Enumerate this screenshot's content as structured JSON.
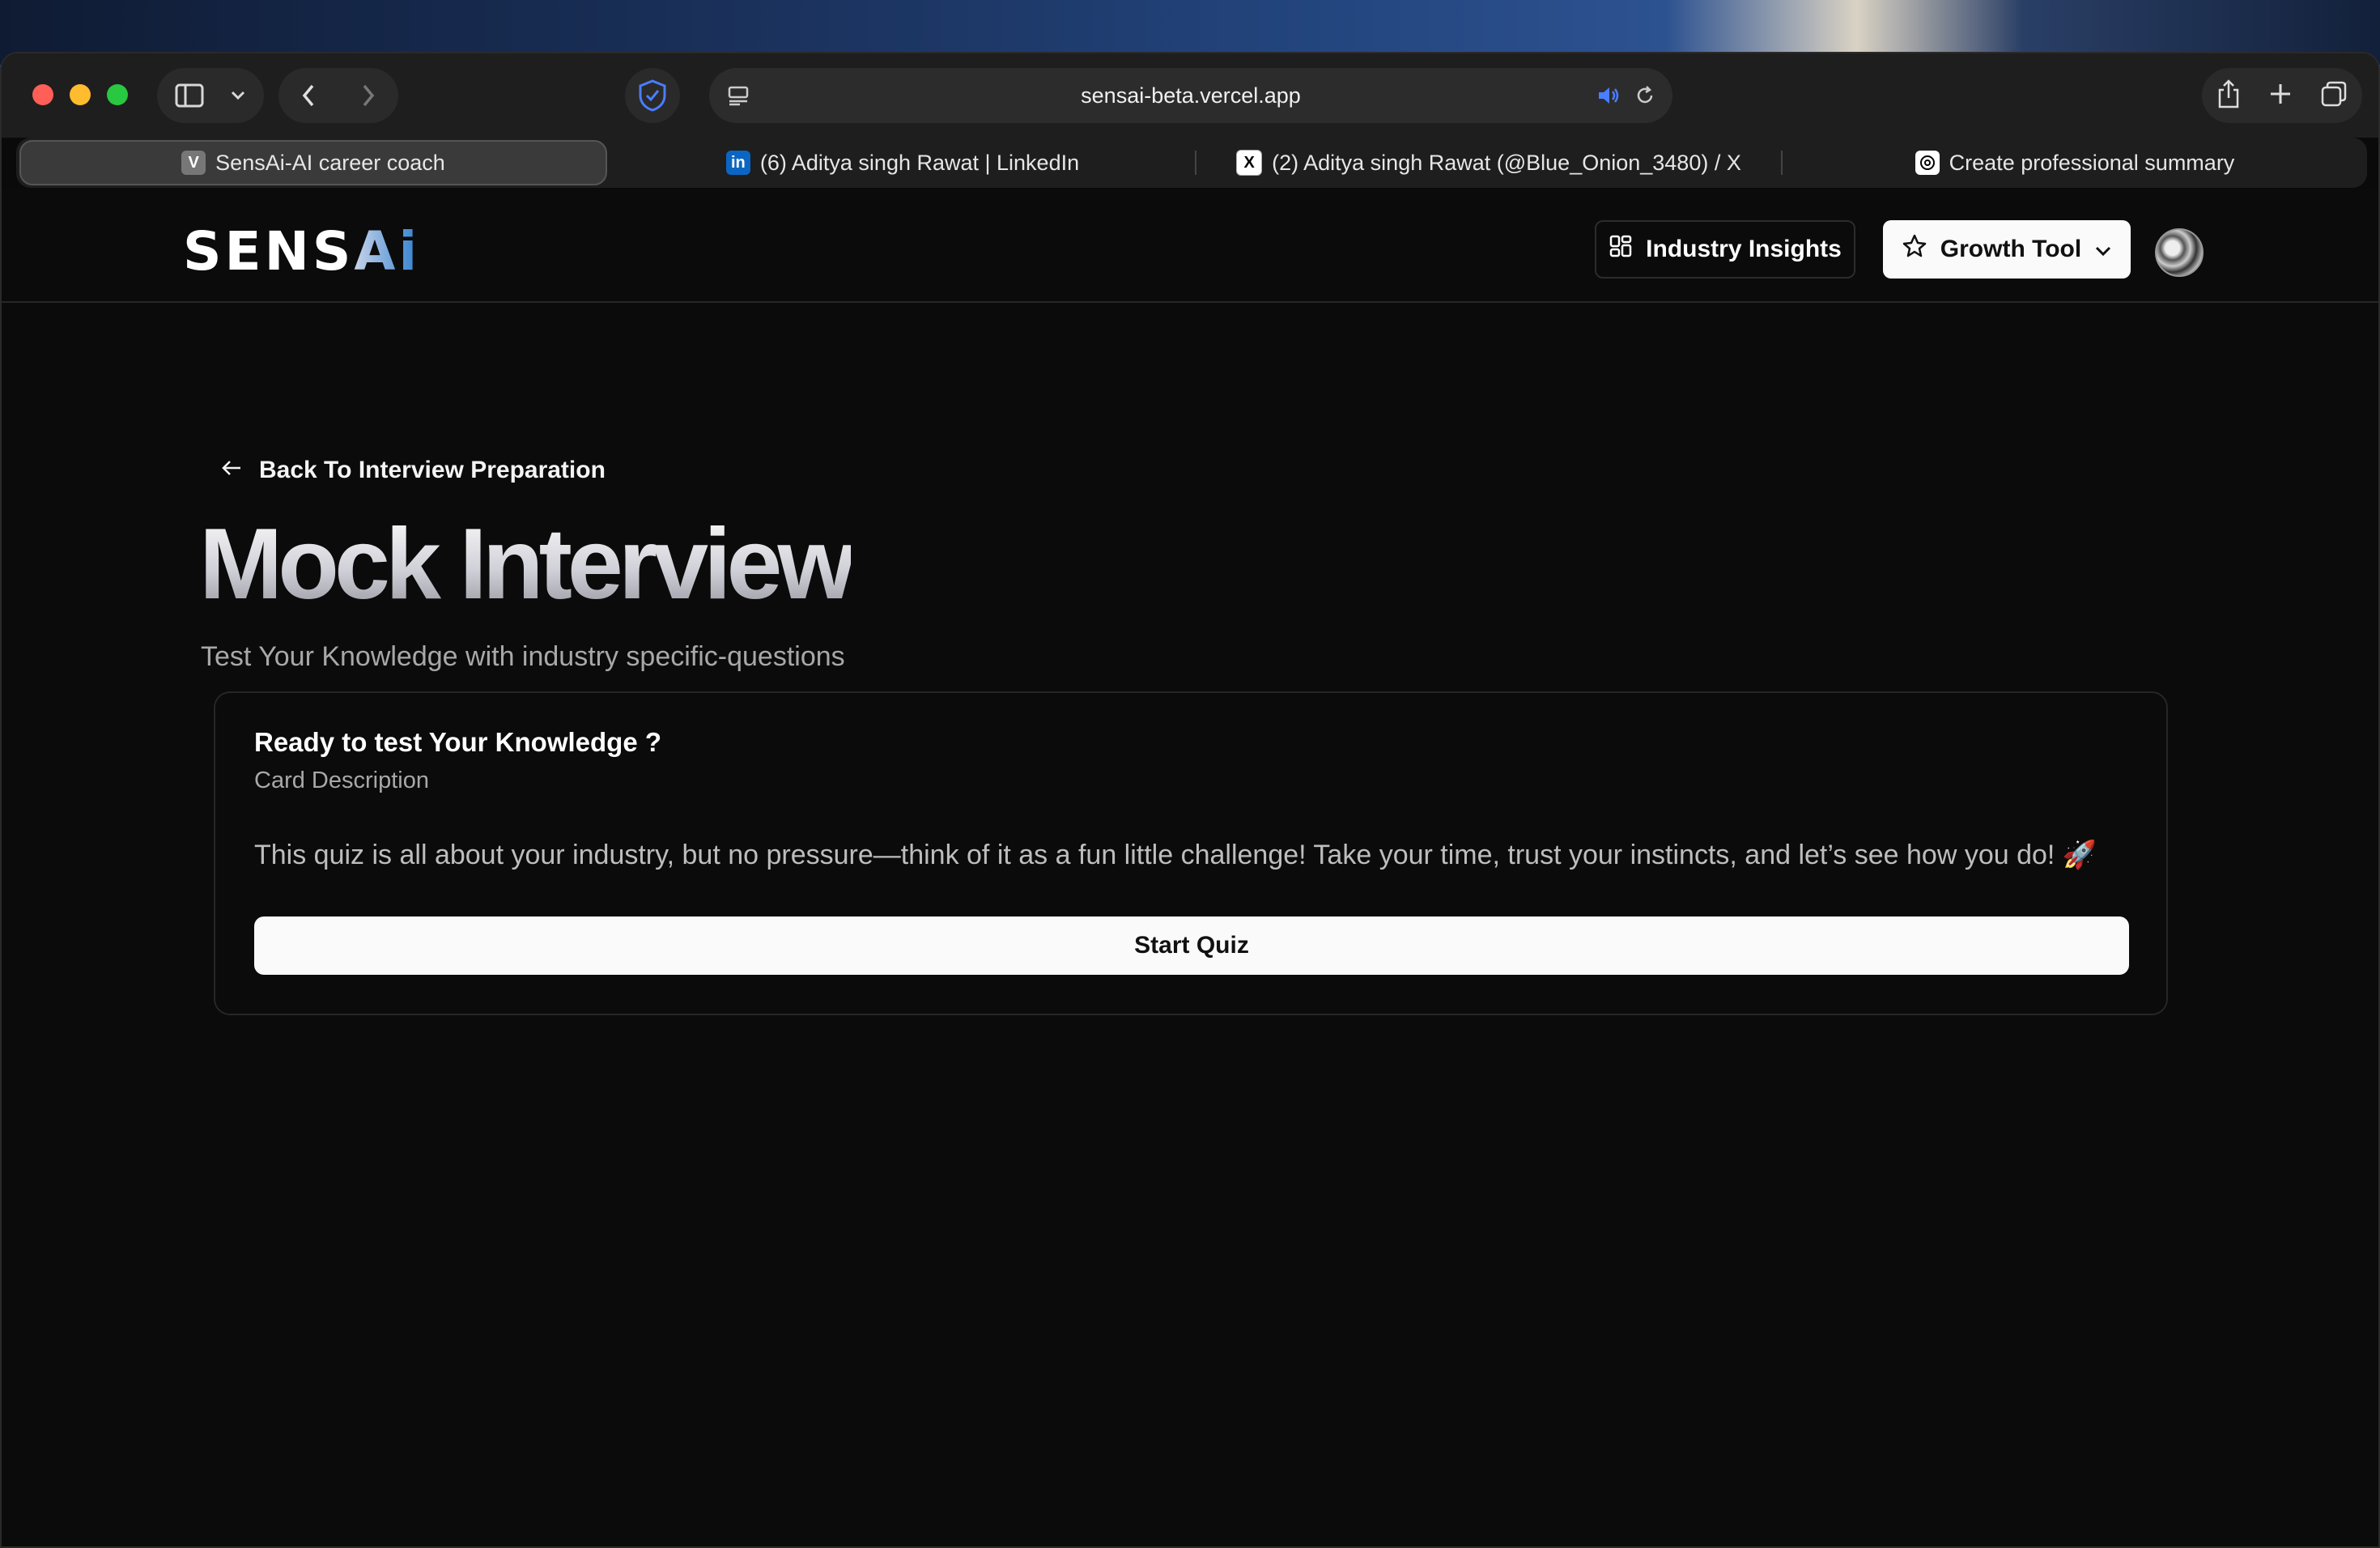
{
  "browser": {
    "url": "sensai-beta.vercel.app",
    "tabs": [
      {
        "favicon": "V",
        "label": "SensAi-AI career coach",
        "active": true
      },
      {
        "favicon": "in",
        "label": "(6) Aditya singh Rawat | LinkedIn",
        "active": false
      },
      {
        "favicon": "X",
        "label": "(2) Aditya singh Rawat (@Blue_Onion_3480) / X",
        "active": false
      },
      {
        "favicon": "gpt",
        "label": "Create professional summary",
        "active": false
      }
    ]
  },
  "header": {
    "logo_main": "SENS",
    "logo_ai": "Ai",
    "industry_insights": "Industry Insights",
    "growth_tool": "Growth Tool"
  },
  "page": {
    "back_link": "Back To Interview Preparation",
    "title": "Mock Interview",
    "subtitle": "Test Your Knowledge with industry specific-questions"
  },
  "card": {
    "title": "Ready to test Your Knowledge ?",
    "description": "Card Description",
    "text": "This quiz is all about your industry, but no pressure—think of it as a fun little challenge! Take your time, trust your instincts, and let’s see how you do! 🚀",
    "button": "Start Quiz"
  }
}
